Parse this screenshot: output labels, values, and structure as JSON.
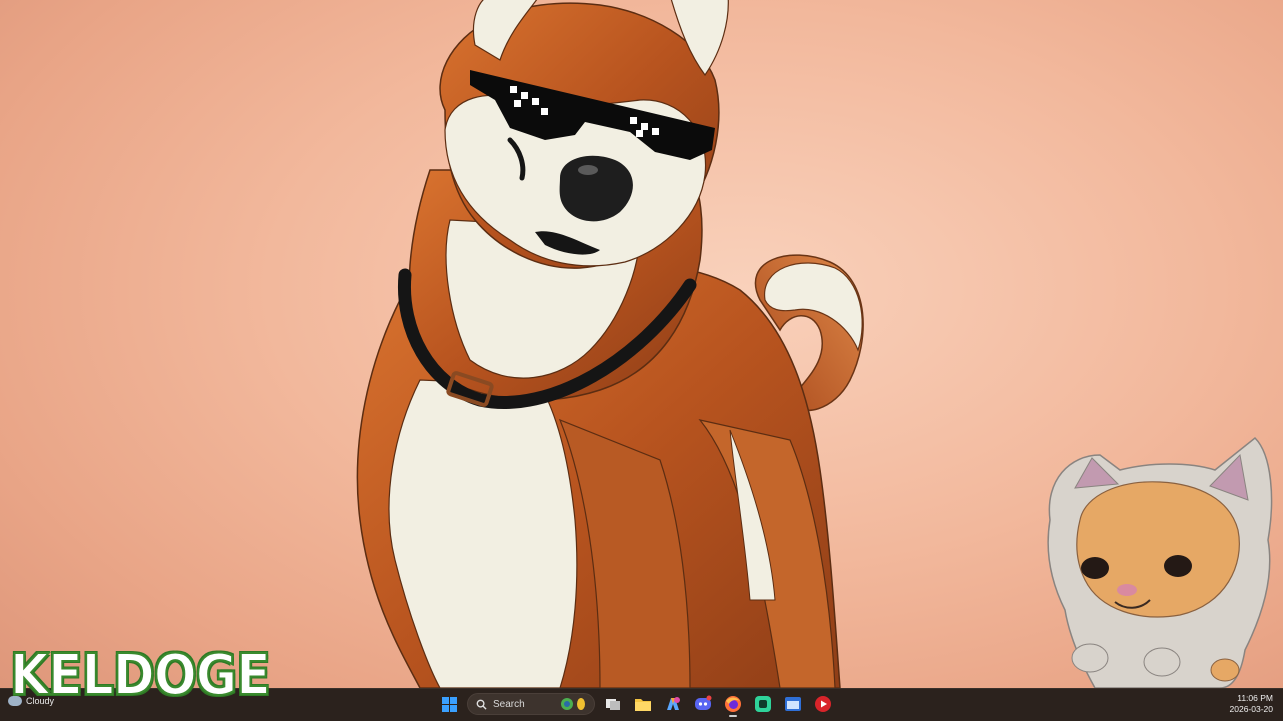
{
  "overlay": {
    "logo_text": "KELDOGE"
  },
  "taskbar": {
    "weather": {
      "label": "Cloudy",
      "icon": "cloud-icon"
    },
    "search": {
      "placeholder": "Search"
    },
    "pinned": [
      {
        "name": "start-button",
        "icon": "windows-logo-icon"
      },
      {
        "name": "search-box",
        "icon": "search-icon"
      },
      {
        "name": "copilot-widget",
        "icon": "copilot-icon"
      },
      {
        "name": "task-view-button",
        "icon": "task-view-icon"
      },
      {
        "name": "file-explorer-button",
        "icon": "folder-icon"
      },
      {
        "name": "copilot-button",
        "icon": "copilot-icon"
      },
      {
        "name": "discord-button",
        "icon": "discord-icon"
      },
      {
        "name": "firefox-button",
        "icon": "firefox-icon"
      },
      {
        "name": "app-green-button",
        "icon": "green-app-icon"
      },
      {
        "name": "app-window-button",
        "icon": "window-app-icon"
      },
      {
        "name": "app-red-button",
        "icon": "red-play-icon"
      }
    ],
    "clock": {
      "time": "11:06 PM",
      "date": "2026-03-20"
    }
  },
  "colors": {
    "wallpaper_bg": "#f2b89c",
    "taskbar_bg": "#2b221d",
    "dog_orange": "#c8622a",
    "dog_cream": "#f2efe2",
    "logo_green": "#3a8a2e"
  }
}
